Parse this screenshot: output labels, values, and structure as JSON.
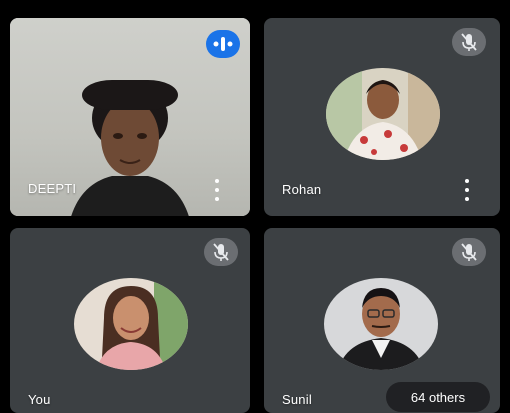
{
  "participants": [
    {
      "name": "DEEPTI",
      "state": "speaking",
      "video": "on"
    },
    {
      "name": "Rohan",
      "state": "muted",
      "video": "off"
    },
    {
      "name": "You",
      "state": "muted",
      "video": "off"
    },
    {
      "name": "Sunil",
      "state": "muted",
      "video": "off"
    }
  ],
  "others_label": "64 others",
  "colors": {
    "tile": "#3c4043",
    "speaking": "#1a73e8",
    "mute_badge": "#6b6e72",
    "background": "#000000"
  },
  "icons": {
    "speaking": "audio-level-icon",
    "muted": "mic-off-icon",
    "more": "more-vert-icon"
  }
}
